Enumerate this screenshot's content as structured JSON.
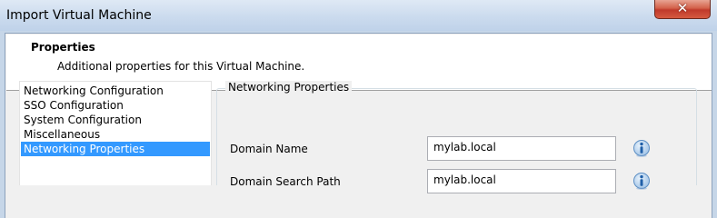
{
  "window": {
    "title": "Import Virtual Machine",
    "close_glyph": "✕"
  },
  "header": {
    "title": "Properties",
    "subtitle": "Additional properties for this Virtual Machine."
  },
  "nav": {
    "items": [
      {
        "label": "Networking Configuration",
        "selected": false
      },
      {
        "label": "SSO Configuration",
        "selected": false
      },
      {
        "label": "System Configuration",
        "selected": false
      },
      {
        "label": "Miscellaneous",
        "selected": false
      },
      {
        "label": "Networking Properties",
        "selected": true
      }
    ]
  },
  "panel": {
    "group_title": "Networking Properties",
    "fields": [
      {
        "label": "Domain Name",
        "value": "mylab.local",
        "icon": "info-icon"
      },
      {
        "label": "Domain Search Path",
        "value": "mylab.local",
        "icon": "info-icon"
      }
    ]
  },
  "colors": {
    "selection": "#3399ff",
    "info_icon": "#2a6fb8"
  }
}
